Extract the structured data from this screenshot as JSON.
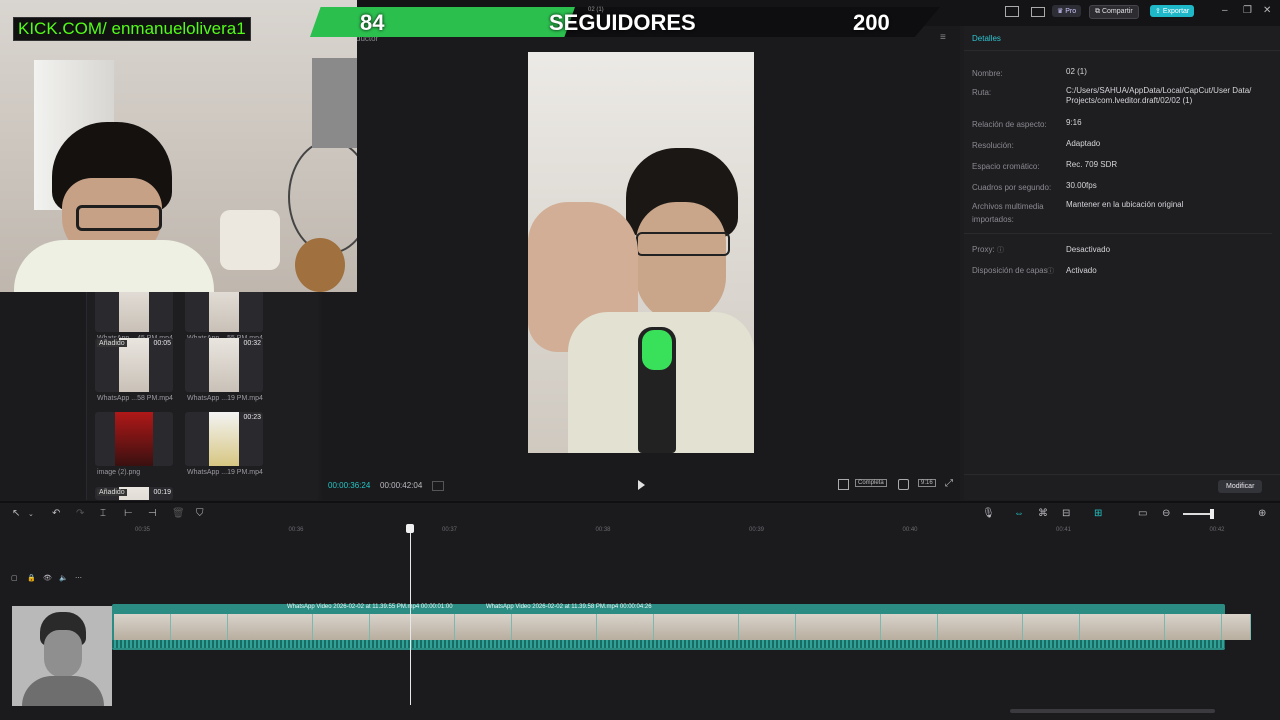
{
  "overlay": {
    "kick_text": "KICK.COM/ enmanuelolivera1",
    "follower_current": "84",
    "follower_label": "SEGUIDORES",
    "follower_goal": "200",
    "progress_fraction": 0.42,
    "tiny_label": "02 (1)"
  },
  "header": {
    "pro_label": "Pro",
    "share_label": "Compartir",
    "export_label": "Exportar",
    "player_label": "ductor"
  },
  "media": {
    "items": [
      {
        "caption": "WhatsApp ...45 PM.mp4",
        "duration": "",
        "badge": ""
      },
      {
        "caption": "WhatsApp ...55 PM.mp4",
        "duration": "",
        "badge": ""
      },
      {
        "caption": "WhatsApp ...58 PM.mp4",
        "duration": "00:05",
        "badge": "Añadido"
      },
      {
        "caption": "WhatsApp ...19 PM.mp4",
        "duration": "00:32",
        "badge": ""
      },
      {
        "caption": "image (2).png",
        "duration": "",
        "badge": ""
      },
      {
        "caption": "WhatsApp ...19 PM.mp4",
        "duration": "00:23",
        "badge": ""
      },
      {
        "caption": "",
        "duration": "00:19",
        "badge": "Añadido"
      }
    ]
  },
  "player": {
    "current_time": "00:00:36:24",
    "total_time": "00:00:42:04",
    "complete_label": "Completa",
    "ratio_label": "9:16"
  },
  "details": {
    "tab": "Detalles",
    "rows": [
      {
        "label": "Nombre:",
        "value": "02 (1)"
      },
      {
        "label": "Ruta:",
        "value": "C:/Users/SAHUA/AppData/Local/CapCut/User Data/ Projects/com.lveditor.draft/02/02 (1)"
      },
      {
        "label": "Relación de aspecto:",
        "value": "9:16"
      },
      {
        "label": "Resolución:",
        "value": "Adaptado"
      },
      {
        "label": "Espacio cromático:",
        "value": "Rec. 709 SDR"
      },
      {
        "label": "Cuadros por segundo:",
        "value": "30.00fps"
      },
      {
        "label": "Archivos multimedia importados:",
        "value": "Mantener en la ubicación original"
      }
    ],
    "proxy_label": "Proxy:",
    "proxy_value": "Desactivado",
    "layers_label": "Disposición de capas",
    "layers_value": "Activado",
    "modify_label": "Modificar"
  },
  "timeline": {
    "ruler": [
      "00:35",
      "00:36",
      "00:37",
      "00:38",
      "00:39",
      "00:40",
      "00:41",
      "00:42"
    ],
    "clip1_label": "WhatsApp Video 2026-02-02 at 11.39.55 PM.mp4   00:00:01:00",
    "clip2_label": "WhatsApp Video 2026-02-02 at 11.39.58 PM.mp4   00:00:04:26"
  },
  "colors": {
    "accent": "#22c3c3",
    "kick_green": "#53fc18",
    "export_bg": "#1fb8c9"
  }
}
